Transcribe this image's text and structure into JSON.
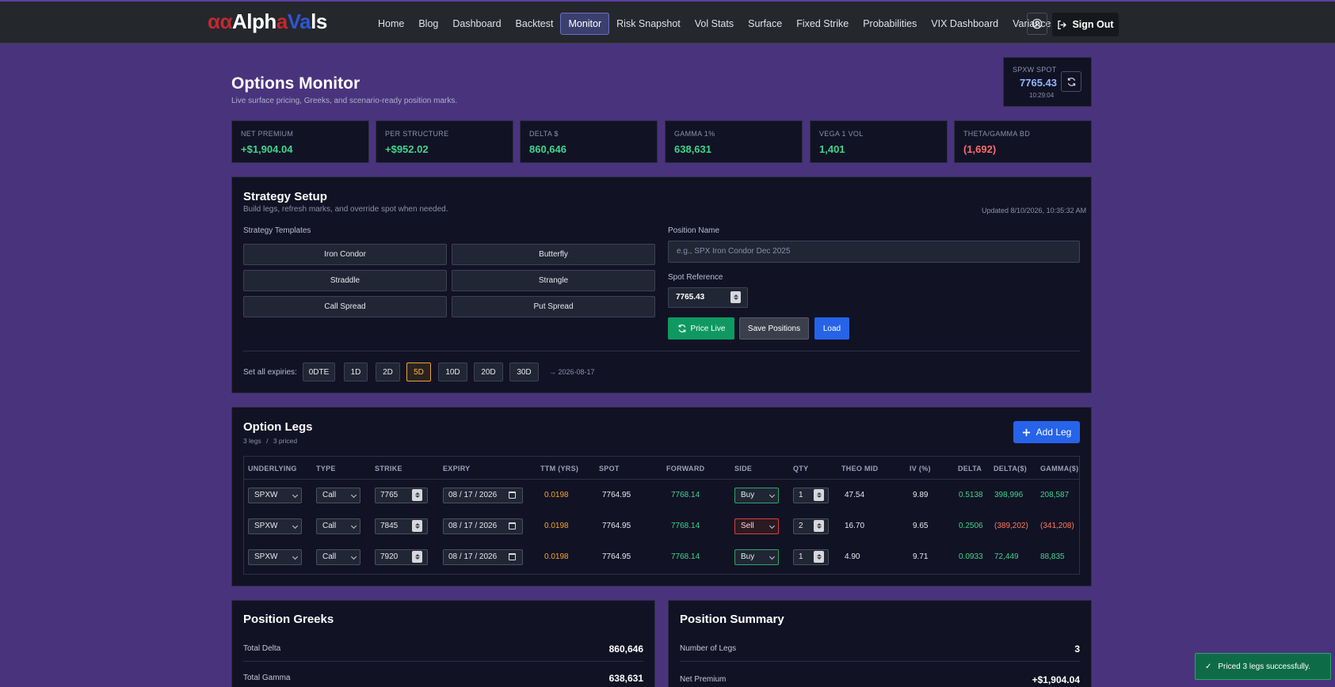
{
  "brand": {
    "p1": "αα",
    "p2": "Alph",
    "p3": "a",
    "p4": "V",
    "p5": "a",
    "p6": "ls"
  },
  "nav": [
    {
      "label": "Home"
    },
    {
      "label": "Blog"
    },
    {
      "label": "Dashboard"
    },
    {
      "label": "Backtest"
    },
    {
      "label": "Monitor",
      "active": true
    },
    {
      "label": "Risk Snapshot"
    },
    {
      "label": "Vol Stats"
    },
    {
      "label": "Surface"
    },
    {
      "label": "Fixed Strike"
    },
    {
      "label": "Probabilities"
    },
    {
      "label": "VIX Dashboard"
    },
    {
      "label": "Variance"
    }
  ],
  "signout_label": "Sign Out",
  "header": {
    "title": "Options Monitor",
    "subtitle": "Live surface pricing, Greeks, and scenario-ready position marks."
  },
  "spot": {
    "label": "SPXW SPOT",
    "value": "7765.43",
    "time": "10:29:04"
  },
  "metrics": [
    {
      "label": "NET PREMIUM",
      "value": "+$1,904.04"
    },
    {
      "label": "PER STRUCTURE",
      "value": "+$952.02"
    },
    {
      "label": "DELTA $",
      "value": "860,646"
    },
    {
      "label": "GAMMA 1%",
      "value": "638,631"
    },
    {
      "label": "VEGA 1 VOL",
      "value": "1,401"
    },
    {
      "label": "THETA/GAMMA BD",
      "value": "(1,692)"
    }
  ],
  "strategy": {
    "title": "Strategy Setup",
    "subtitle": "Build legs, refresh marks, and override spot when needed.",
    "updated": "Updated 8/10/2026, 10:35:32 AM",
    "templates_label": "Strategy Templates",
    "templates": [
      "Iron Condor",
      "Butterfly",
      "Straddle",
      "Strangle",
      "Call Spread",
      "Put Spread"
    ],
    "position_name_label": "Position Name",
    "position_name_placeholder": "e.g., SPX Iron Condor Dec 2025",
    "spot_ref_label": "Spot Reference",
    "spot_ref_value": "7765.43",
    "price_live": "Price Live",
    "save_positions": "Save Positions",
    "load": "Load",
    "set_expiries_label": "Set all expiries:",
    "expiries": [
      "0DTE",
      "1D",
      "2D",
      "5D",
      "10D",
      "20D",
      "30D"
    ],
    "active_expiry": "5D",
    "expiry_target": "→ 2026-08-17"
  },
  "legs": {
    "title": "Option Legs",
    "count": "3 legs",
    "sep": "/",
    "priced": "3 priced",
    "add_label": "Add Leg",
    "columns": [
      "UNDERLYING",
      "TYPE",
      "STRIKE",
      "EXPIRY",
      "TTM (YRS)",
      "SPOT",
      "FORWARD",
      "SIDE",
      "QTY",
      "THEO MID",
      "IV (%)",
      "DELTA",
      "DELTA($)",
      "GAMMA($)"
    ],
    "rows": [
      {
        "underlying": "SPXW",
        "type": "Call",
        "strike": "7765",
        "expiry": "08 / 17 / 2026",
        "ttm": "0.0198",
        "spot": "7764.95",
        "forward": "7768.14",
        "side": "Buy",
        "qty": "1",
        "theo": "47.54",
        "iv": "9.89",
        "delta": "0.5138",
        "delta_d": "398,996",
        "gamma_d": "208,587"
      },
      {
        "underlying": "SPXW",
        "type": "Call",
        "strike": "7845",
        "expiry": "08 / 17 / 2026",
        "ttm": "0.0198",
        "spot": "7764.95",
        "forward": "7768.14",
        "side": "Sell",
        "qty": "2",
        "theo": "16.70",
        "iv": "9.65",
        "delta": "0.2506",
        "delta_d": "(389,202)",
        "gamma_d": "(341,208)"
      },
      {
        "underlying": "SPXW",
        "type": "Call",
        "strike": "7920",
        "expiry": "08 / 17 / 2026",
        "ttm": "0.0198",
        "spot": "7764.95",
        "forward": "7768.14",
        "side": "Buy",
        "qty": "1",
        "theo": "4.90",
        "iv": "9.71",
        "delta": "0.0933",
        "delta_d": "72,449",
        "gamma_d": "88,835"
      }
    ]
  },
  "greeks": {
    "title": "Position Greeks",
    "items": [
      {
        "label": "Total Delta",
        "value": "860,646"
      },
      {
        "label": "Total Gamma",
        "value": "638,631"
      }
    ]
  },
  "summary": {
    "title": "Position Summary",
    "items": [
      {
        "label": "Number of Legs",
        "value": "3"
      },
      {
        "label": "Net Premium",
        "value": "+$1,904.04"
      }
    ]
  },
  "toast": {
    "check": "✓",
    "message": "Priced 3 legs successfully."
  }
}
